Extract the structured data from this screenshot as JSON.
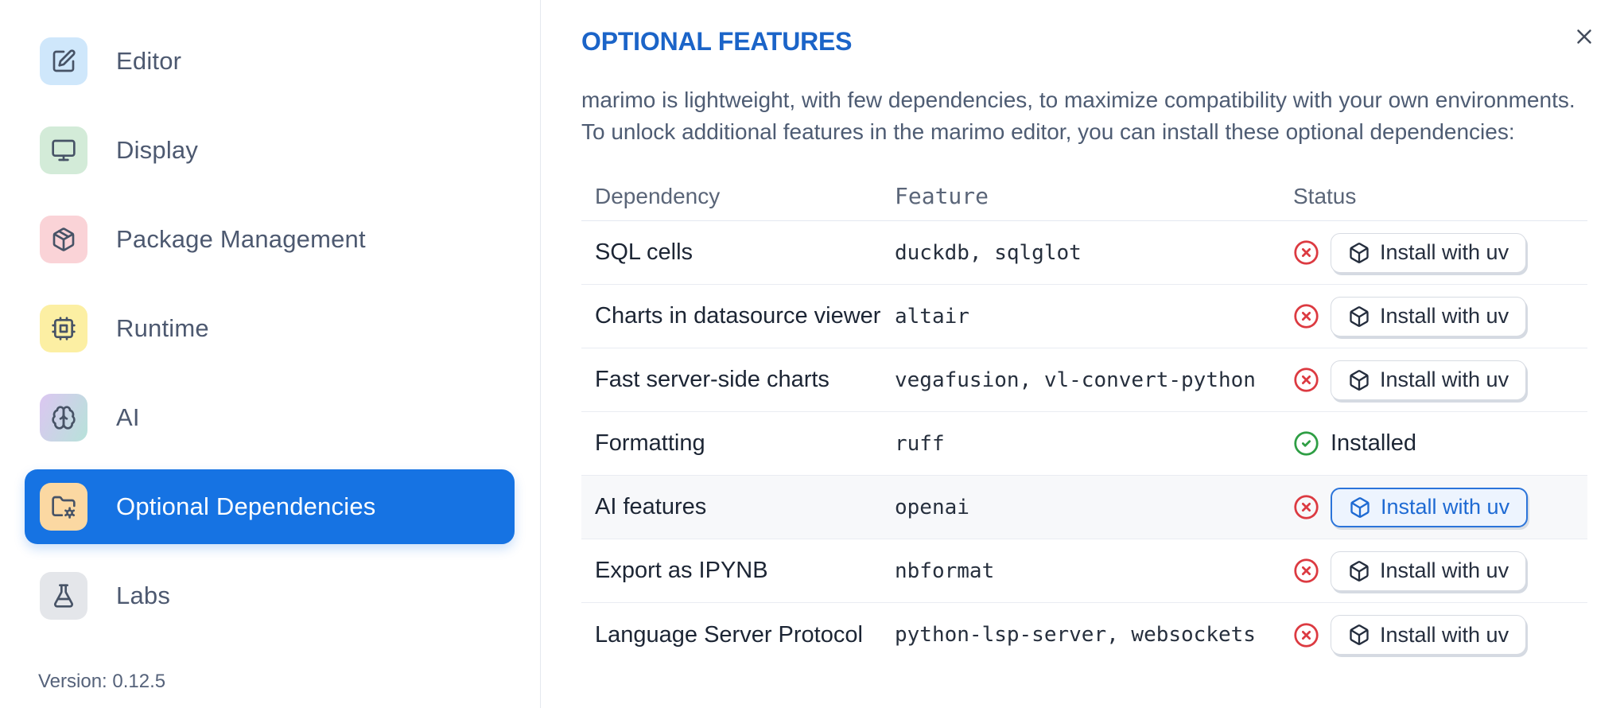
{
  "colors": {
    "accent_blue": "#1673e3",
    "title_blue": "#1b64c8",
    "error_red": "#dc3a41",
    "success_green": "#2e9e44"
  },
  "sidebar": {
    "items": [
      {
        "label": "Editor",
        "icon": "square-pen",
        "icon_bg": "#cfe7fb",
        "selected": false
      },
      {
        "label": "Display",
        "icon": "monitor",
        "icon_bg": "#d3ebd8",
        "selected": false
      },
      {
        "label": "Package Management",
        "icon": "package",
        "icon_bg": "#fad3d7",
        "selected": false
      },
      {
        "label": "Runtime",
        "icon": "cpu",
        "icon_bg": "#fcefa3",
        "selected": false
      },
      {
        "label": "AI",
        "icon": "brain",
        "icon_bg": "linear-gradient(115deg,#dac8f0 5%,#b9e1db 95%)",
        "selected": false
      },
      {
        "label": "Optional Dependencies",
        "icon": "folder-cog",
        "icon_bg": "#fbd8a2",
        "selected": true
      },
      {
        "label": "Labs",
        "icon": "flask",
        "icon_bg": "#e4e6ea",
        "selected": false
      }
    ],
    "version_label": "Version: 0.12.5"
  },
  "panel": {
    "title": "OPTIONAL FEATURES",
    "description_line1": "marimo is lightweight, with few dependencies, to maximize compatibility with your own environments.",
    "description_line2": "To unlock additional features in the marimo editor, you can install these optional dependencies:",
    "table": {
      "headers": {
        "dependency": "Dependency",
        "feature": "Feature",
        "status": "Status"
      },
      "install_button_label": "Install with uv",
      "installed_label": "Installed",
      "rows": [
        {
          "dependency": "SQL cells",
          "feature": "duckdb, sqlglot",
          "installed": false,
          "highlighted": false
        },
        {
          "dependency": "Charts in datasource viewer",
          "feature": "altair",
          "installed": false,
          "highlighted": false
        },
        {
          "dependency": "Fast server-side charts",
          "feature": "vegafusion, vl-convert-python",
          "installed": false,
          "highlighted": false
        },
        {
          "dependency": "Formatting",
          "feature": "ruff",
          "installed": true,
          "highlighted": false
        },
        {
          "dependency": "AI features",
          "feature": "openai",
          "installed": false,
          "highlighted": true
        },
        {
          "dependency": "Export as IPYNB",
          "feature": "nbformat",
          "installed": false,
          "highlighted": false
        },
        {
          "dependency": "Language Server Protocol",
          "feature": "python-lsp-server, websockets",
          "installed": false,
          "highlighted": false
        }
      ]
    }
  }
}
